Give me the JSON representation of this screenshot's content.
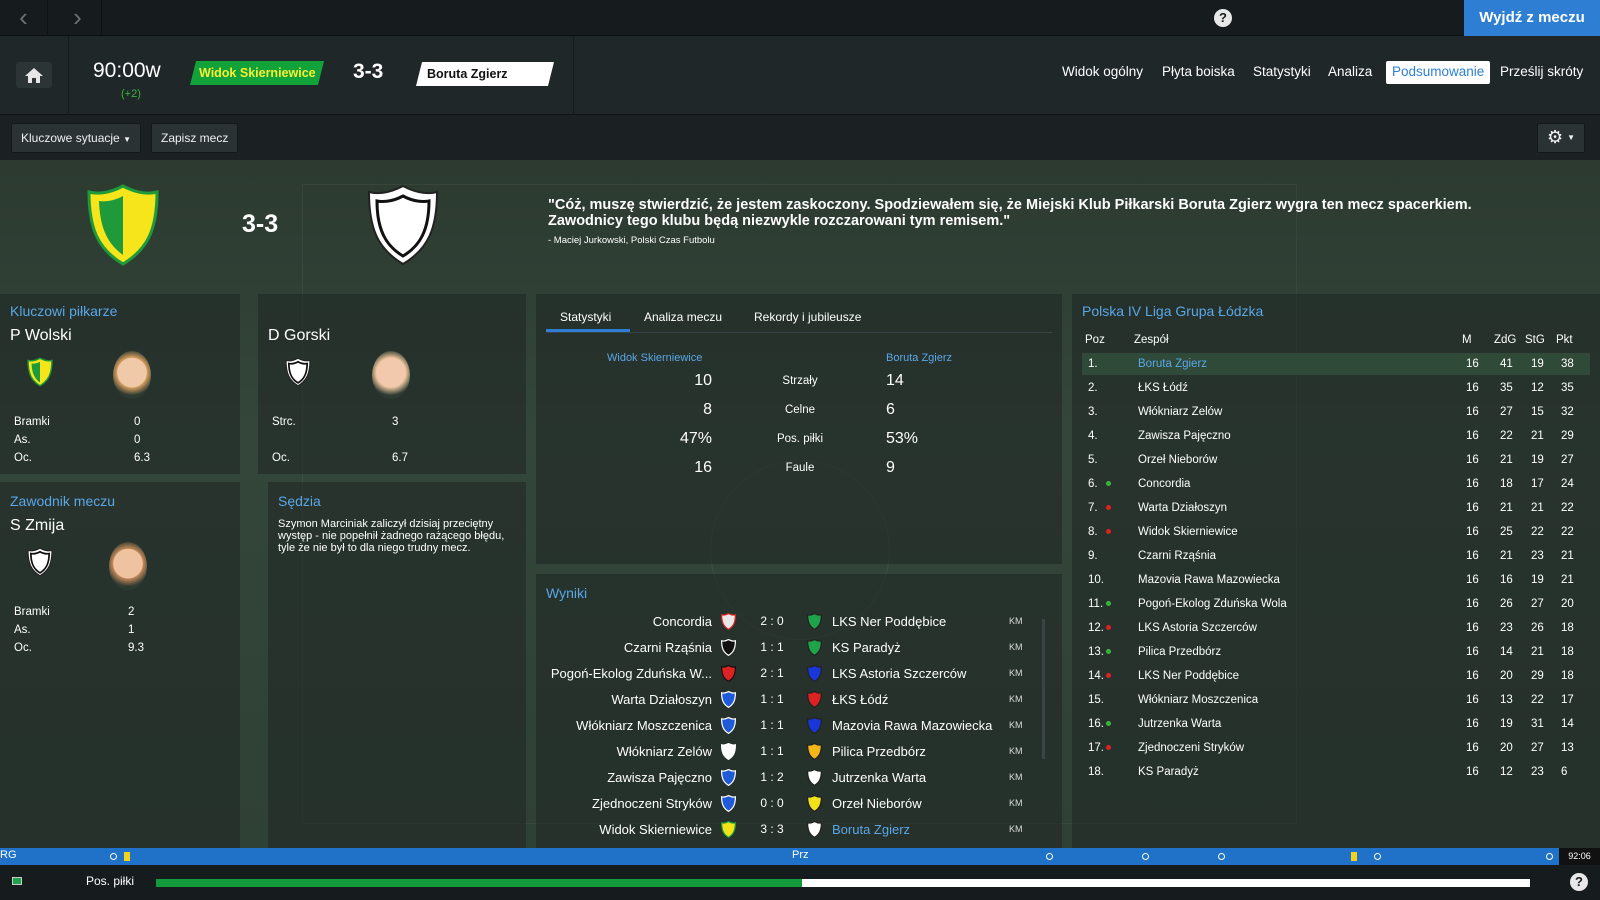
{
  "topbar": {
    "exit_label": "Wyjdź z meczu",
    "help_label": "?"
  },
  "header": {
    "clock": "90:00w",
    "added_time": "(+2)",
    "home_team": "Widok Skierniewice",
    "score": "3-3",
    "away_team": "Boruta Zgierz",
    "tabs": [
      {
        "label": "Widok ogólny"
      },
      {
        "label": "Płyta boiska"
      },
      {
        "label": "Statystyki"
      },
      {
        "label": "Analiza"
      },
      {
        "label": "Podsumowanie"
      },
      {
        "label": "Prześlij skróty"
      }
    ],
    "active_tab": "Podsumowanie"
  },
  "subbar": {
    "key_moments": "Kluczowe sytuacje",
    "save_match": "Zapisz mecz"
  },
  "summary": {
    "score": "3-3",
    "quote": "\"Cóż, muszę stwierdzić, że jestem zaskoczony. Spodziewałem się, że Miejski Klub Piłkarski Boruta Zgierz wygra ten mecz spacerkiem. Zawodnicy tego klubu będą niezwykle rozczarowani tym remisem.\"",
    "quote_author": "- Maciej Jurkowski, Polski Czas Futbolu"
  },
  "key_players": {
    "title": "Kluczowi piłkarze",
    "home": {
      "name": "P Wolski",
      "stats": [
        {
          "label": "Bramki",
          "value": "0"
        },
        {
          "label": "As.",
          "value": "0"
        },
        {
          "label": "Oc.",
          "value": "6.3"
        }
      ]
    },
    "away": {
      "name": "D Gorski",
      "stats": [
        {
          "label": "Strc.",
          "value": "3"
        },
        {
          "label": "Oc.",
          "value": "6.7"
        }
      ]
    }
  },
  "motm": {
    "title": "Zawodnik meczu",
    "name": "S Zmija",
    "stats": [
      {
        "label": "Bramki",
        "value": "2"
      },
      {
        "label": "As.",
        "value": "1"
      },
      {
        "label": "Oc.",
        "value": "9.3"
      }
    ]
  },
  "referee": {
    "title": "Sędzia",
    "text": "Szymon Marciniak zaliczył dzisiaj przeciętny występ - nie popełnił żadnego rażącego błędu, tyle że nie był to dla niego trudny mecz."
  },
  "stats_panel": {
    "tabs": [
      "Statystyki",
      "Analiza meczu",
      "Rekordy i jubileusze"
    ],
    "home": "Widok Skierniewice",
    "away": "Boruta Zgierz",
    "rows": [
      {
        "label": "Strzały",
        "home": "10",
        "away": "14"
      },
      {
        "label": "Celne",
        "home": "8",
        "away": "6"
      },
      {
        "label": "Pos. piłki",
        "home": "47%",
        "away": "53%"
      },
      {
        "label": "Faule",
        "home": "16",
        "away": "9"
      }
    ]
  },
  "results": {
    "title": "Wyniki",
    "rows": [
      {
        "home": "Concordia",
        "score": "2 : 0",
        "away": "LKS Ner Poddębice",
        "tag": "KM",
        "hc": "#e8e8e8",
        "hs": "#d22",
        "ac": "#1fa34a"
      },
      {
        "home": "Czarni Rząśnia",
        "score": "1 : 1",
        "away": "KS Paradyż",
        "tag": "KM",
        "hc": "#111",
        "hs": "#fff",
        "ac": "#1fa34a"
      },
      {
        "home": "Pogoń-Ekolog Zduńska W...",
        "score": "2 : 1",
        "away": "LKS Astoria Szczerców",
        "tag": "KM",
        "hc": "#d22",
        "hs": "#111",
        "ac": "#1936d8"
      },
      {
        "home": "Warta Działoszyn",
        "score": "1 : 1",
        "away": "ŁKS Łódź",
        "tag": "KM",
        "hc": "#1f5ad8",
        "hs": "#fff",
        "ac": "#d22"
      },
      {
        "home": "Włókniarz Moszczenica",
        "score": "1 : 1",
        "away": "Mazovia Rawa Mazowiecka",
        "tag": "KM",
        "hc": "#1f5ad8",
        "hs": "#fff",
        "ac": "#1936d8"
      },
      {
        "home": "Włókniarz Zelów",
        "score": "1 : 1",
        "away": "Pilica Przedbórz",
        "tag": "KM",
        "hc": "#fff",
        "hs": "#fff",
        "ac": "#f2b51a"
      },
      {
        "home": "Zawisza Pajęczno",
        "score": "1 : 2",
        "away": "Jutrzenka Warta",
        "tag": "KM",
        "hc": "#1f5ad8",
        "hs": "#fff",
        "ac": "#fff"
      },
      {
        "home": "Zjednoczeni Stryków",
        "score": "0 : 0",
        "away": "Orzeł Nieborów",
        "tag": "KM",
        "hc": "#1f5ad8",
        "hs": "#fff",
        "ac": "#f2e21a"
      },
      {
        "home": "Widok Skierniewice",
        "score": "3 : 3",
        "away": "Boruta Zgierz",
        "tag": "KM",
        "hc": "#f2e21a",
        "hs": "#1a9a3a",
        "ac": "#fff"
      }
    ]
  },
  "league": {
    "title": "Polska IV Liga Grupa Łódzka",
    "headers": {
      "pos": "Poz",
      "team": "Zespół",
      "m": "M",
      "zdg": "ZdG",
      "stg": "StG",
      "pkt": "Pkt"
    },
    "rows": [
      {
        "pos": "1.",
        "arrow": "",
        "team": "Boruta Zgierz",
        "m": "16",
        "zdg": "41",
        "stg": "19",
        "pkt": "38"
      },
      {
        "pos": "2.",
        "arrow": "",
        "team": "ŁKS Łódź",
        "m": "16",
        "zdg": "35",
        "stg": "12",
        "pkt": "35"
      },
      {
        "pos": "3.",
        "arrow": "",
        "team": "Włókniarz Zelów",
        "m": "16",
        "zdg": "27",
        "stg": "15",
        "pkt": "32"
      },
      {
        "pos": "4.",
        "arrow": "",
        "team": "Zawisza Pajęczno",
        "m": "16",
        "zdg": "22",
        "stg": "21",
        "pkt": "29"
      },
      {
        "pos": "5.",
        "arrow": "",
        "team": "Orzeł Nieborów",
        "m": "16",
        "zdg": "21",
        "stg": "19",
        "pkt": "27"
      },
      {
        "pos": "6.",
        "arrow": "up",
        "team": "Concordia",
        "m": "16",
        "zdg": "18",
        "stg": "17",
        "pkt": "24"
      },
      {
        "pos": "7.",
        "arrow": "down",
        "team": "Warta Działoszyn",
        "m": "16",
        "zdg": "21",
        "stg": "21",
        "pkt": "22"
      },
      {
        "pos": "8.",
        "arrow": "down",
        "team": "Widok Skierniewice",
        "m": "16",
        "zdg": "25",
        "stg": "22",
        "pkt": "22"
      },
      {
        "pos": "9.",
        "arrow": "",
        "team": "Czarni Rząśnia",
        "m": "16",
        "zdg": "21",
        "stg": "23",
        "pkt": "21"
      },
      {
        "pos": "10.",
        "arrow": "",
        "team": "Mazovia Rawa Mazowiecka",
        "m": "16",
        "zdg": "16",
        "stg": "19",
        "pkt": "21"
      },
      {
        "pos": "11.",
        "arrow": "up",
        "team": "Pogoń-Ekolog Zduńska Wola",
        "m": "16",
        "zdg": "26",
        "stg": "27",
        "pkt": "20"
      },
      {
        "pos": "12.",
        "arrow": "down",
        "team": "LKS Astoria Szczerców",
        "m": "16",
        "zdg": "23",
        "stg": "26",
        "pkt": "18"
      },
      {
        "pos": "13.",
        "arrow": "up",
        "team": "Pilica Przedbórz",
        "m": "16",
        "zdg": "14",
        "stg": "21",
        "pkt": "18"
      },
      {
        "pos": "14.",
        "arrow": "down",
        "team": "LKS Ner Poddębice",
        "m": "16",
        "zdg": "20",
        "stg": "29",
        "pkt": "18"
      },
      {
        "pos": "15.",
        "arrow": "",
        "team": "Włókniarz Moszczenica",
        "m": "16",
        "zdg": "13",
        "stg": "22",
        "pkt": "17"
      },
      {
        "pos": "16.",
        "arrow": "up",
        "team": "Jutrzenka Warta",
        "m": "16",
        "zdg": "19",
        "stg": "31",
        "pkt": "14"
      },
      {
        "pos": "17.",
        "arrow": "down",
        "team": "Zjednoczeni Stryków",
        "m": "16",
        "zdg": "20",
        "stg": "27",
        "pkt": "13"
      },
      {
        "pos": "18.",
        "arrow": "",
        "team": "KS Paradyż",
        "m": "16",
        "zdg": "12",
        "stg": "23",
        "pkt": "6"
      }
    ]
  },
  "timeline": {
    "left_label": "RG",
    "mid_label": "Prz",
    "time": "92:06"
  },
  "possession_bar": {
    "label": "Pos. piłki",
    "home_share": 0.47
  }
}
